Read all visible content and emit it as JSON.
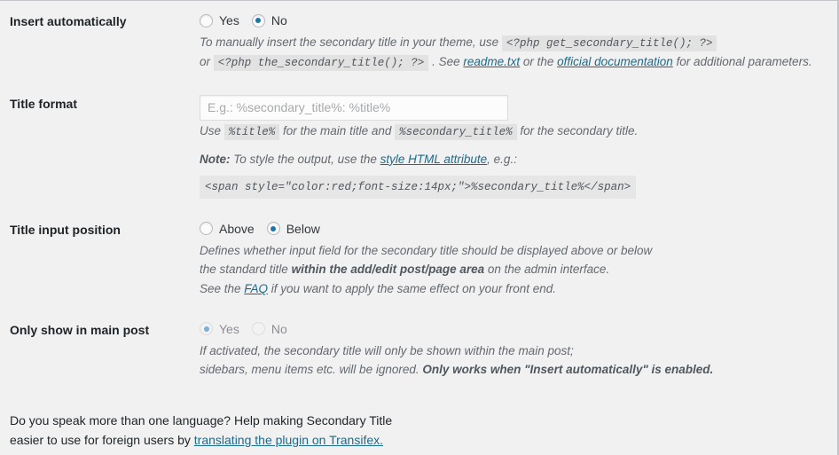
{
  "settings": {
    "rows": [
      {
        "id": "insert-automatically",
        "label": "Insert automatically",
        "control": "radio",
        "options": [
          {
            "label": "Yes",
            "checked": false
          },
          {
            "label": "No",
            "checked": true
          }
        ],
        "disabled": false,
        "description": {
          "line1_pre": "To manually insert the secondary title in your theme, use ",
          "line1_code": "<?php get_secondary_title(); ?>",
          "line2_pre": "or ",
          "line2_code": "<?php the_secondary_title(); ?>",
          "line2_mid": " . See ",
          "line2_link1": "readme.txt",
          "line2_mid2": " or the ",
          "line2_link2": "official documentation",
          "line2_post": " for additional parameters."
        }
      },
      {
        "id": "title-format",
        "label": "Title format",
        "control": "text",
        "value": "",
        "placeholder": "E.g.: %secondary_title%: %title%",
        "description": {
          "use_pre": "Use ",
          "use_code1": "%title%",
          "use_mid": " for the main title and ",
          "use_code2": "%secondary_title%",
          "use_post": " for the secondary title.",
          "note_label": "Note:",
          "note_pre": " To style the output, use the ",
          "note_link": "style HTML attribute",
          "note_post": ", e.g.:",
          "note_code": "<span style=\"color:red;font-size:14px;\">%secondary_title%</span>"
        }
      },
      {
        "id": "title-input-position",
        "label": "Title input position",
        "control": "radio",
        "options": [
          {
            "label": "Above",
            "checked": false
          },
          {
            "label": "Below",
            "checked": true
          }
        ],
        "disabled": false,
        "description": {
          "l1": "Defines whether input field for the secondary title should be displayed above or below",
          "l2_pre": "the standard title ",
          "l2_bold": "within the add/edit post/page area",
          "l2_post": " on the admin interface.",
          "l3_pre": "See the ",
          "l3_link": "FAQ",
          "l3_post": " if you want to apply the same effect on your front end."
        }
      },
      {
        "id": "only-show-in-main-post",
        "label": "Only show in main post",
        "control": "radio",
        "options": [
          {
            "label": "Yes",
            "checked": true
          },
          {
            "label": "No",
            "checked": false
          }
        ],
        "disabled": true,
        "description": {
          "l1": "If activated, the secondary title will only be shown within the main post;",
          "l2_pre": "sidebars, menu items etc. will be ignored. ",
          "l2_bold": "Only works when \"Insert automatically\" is enabled."
        }
      }
    ]
  },
  "footer": {
    "line1": "Do you speak more than one language? Help making Secondary Title",
    "line2_pre": "easier to use for foreign users by ",
    "line2_link": "translating the plugin on Transifex."
  },
  "colors": {
    "background": "#f1f1f1",
    "accent": "#1e73a8",
    "link": "#1d6a8c",
    "label": "#1d2327",
    "description": "#646970",
    "border": "#c3c4c7",
    "code_bg": "#e2e2e2",
    "disabled_accent": "#7eaed3",
    "disabled_text": "#8a8f94"
  }
}
